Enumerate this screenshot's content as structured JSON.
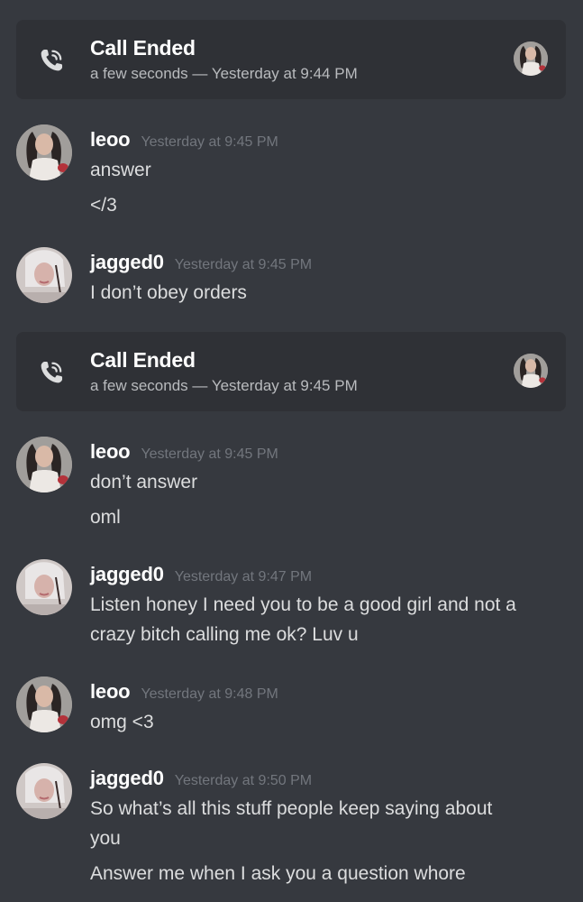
{
  "call1": {
    "title": "Call Ended",
    "subtitle": "a few seconds — Yesterday at 9:44 PM"
  },
  "m1": {
    "user": "leoo",
    "time": "Yesterday at 9:45 PM",
    "lines": [
      "answer",
      "</3"
    ]
  },
  "m2": {
    "user": "jagged0",
    "time": "Yesterday at 9:45 PM",
    "lines": [
      "I don’t obey orders"
    ]
  },
  "call2": {
    "title": "Call Ended",
    "subtitle": "a few seconds — Yesterday at 9:45 PM"
  },
  "m3": {
    "user": "leoo",
    "time": "Yesterday at 9:45 PM",
    "lines": [
      "don’t answer",
      "oml"
    ]
  },
  "m4": {
    "user": "jagged0",
    "time": "Yesterday at 9:47 PM",
    "lines": [
      "Listen honey I need you to be a good girl and not a",
      "crazy bitch calling me ok? Luv u"
    ]
  },
  "m5": {
    "user": "leoo",
    "time": "Yesterday at 9:48 PM",
    "lines": [
      "omg <3"
    ]
  },
  "m6": {
    "user": "jagged0",
    "time": "Yesterday at 9:50 PM",
    "lines": [
      "So what’s all this stuff people keep saying about",
      "you",
      "Answer me when I ask you a question whore"
    ]
  },
  "colors": {
    "background": "#36393f",
    "card": "#2f3136",
    "username": "#ffffff",
    "timestamp": "#72767d",
    "text": "#dcddde"
  }
}
